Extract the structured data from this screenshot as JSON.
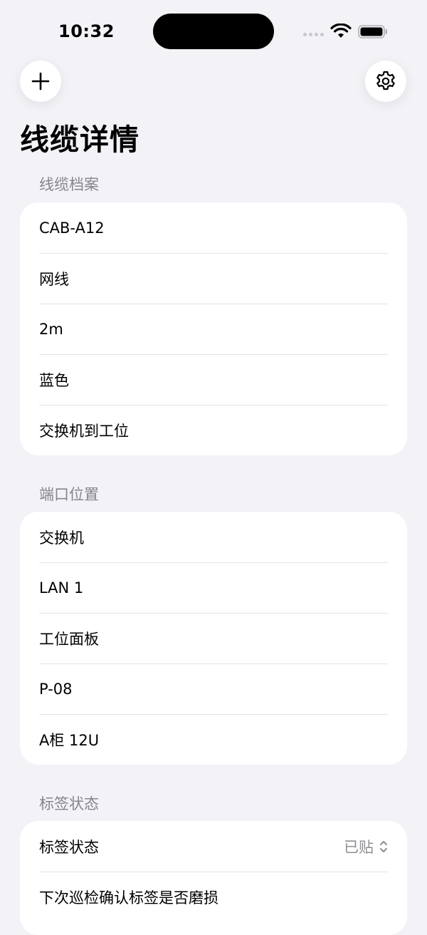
{
  "status_bar": {
    "time": "10:32"
  },
  "header": {
    "title": "线缆详情"
  },
  "sections": [
    {
      "header": "线缆档案",
      "rows": [
        "CAB-A12",
        "网线",
        "2m",
        "蓝色",
        "交换机到工位"
      ]
    },
    {
      "header": "端口位置",
      "rows": [
        "交换机",
        "LAN 1",
        "工位面板",
        "P-08",
        "A柜 12U"
      ]
    },
    {
      "header": "标签状态",
      "label_row": {
        "label": "标签状态",
        "value": "已贴"
      },
      "note_row": "下次巡检确认标签是否磨损"
    }
  ],
  "icons": {
    "add": "plus-icon",
    "settings": "gear-icon",
    "picker": "chevron-up-down-icon"
  }
}
